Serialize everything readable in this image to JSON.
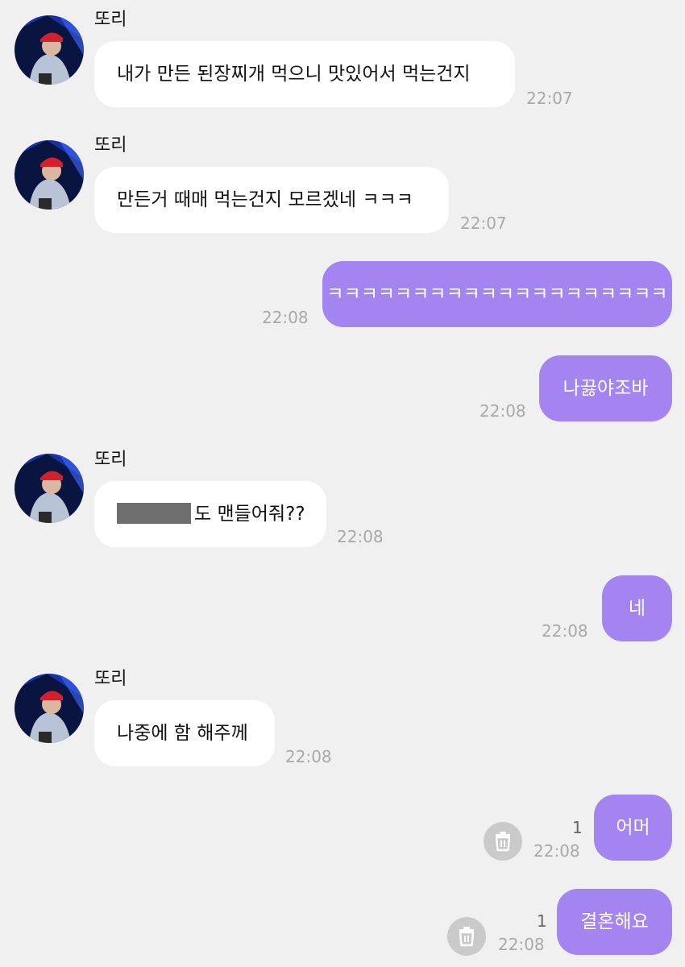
{
  "chat": {
    "sender_name": "또리",
    "messages": [
      {
        "direction": "in",
        "text": "내가 만든 된장찌개 먹으니 맛있어서 먹는건지",
        "time": "22:07"
      },
      {
        "direction": "in",
        "text": "만든거 때매 먹는건지 모르겠네 ㅋㅋㅋ",
        "time": "22:07"
      },
      {
        "direction": "out",
        "text": "ㅋㅋㅋㅋㅋㅋㅋㅋㅋㅋㅋㅋㅋㅋㅋㅋㅋㅋㅋㅋ",
        "time": "22:08"
      },
      {
        "direction": "out",
        "text": "나끓야조바",
        "time": "22:08"
      },
      {
        "direction": "in",
        "text": "도 맨들어줘??",
        "time": "22:08",
        "redacted_prefix": true
      },
      {
        "direction": "out",
        "text": "네",
        "time": "22:08"
      },
      {
        "direction": "in",
        "text": "나중에 함 해주께",
        "time": "22:08"
      },
      {
        "direction": "out",
        "text": "어머",
        "time": "22:08",
        "unread": "1"
      },
      {
        "direction": "out",
        "text": "결혼해요",
        "time": "22:08",
        "unread": "1"
      }
    ]
  },
  "colors": {
    "background": "#f0f0f0",
    "incoming_bubble": "#ffffff",
    "outgoing_bubble": "#a384f1",
    "timestamp": "#a9a9a9"
  },
  "icons": {
    "avatar": "profile-photo",
    "delete": "trash-icon"
  }
}
